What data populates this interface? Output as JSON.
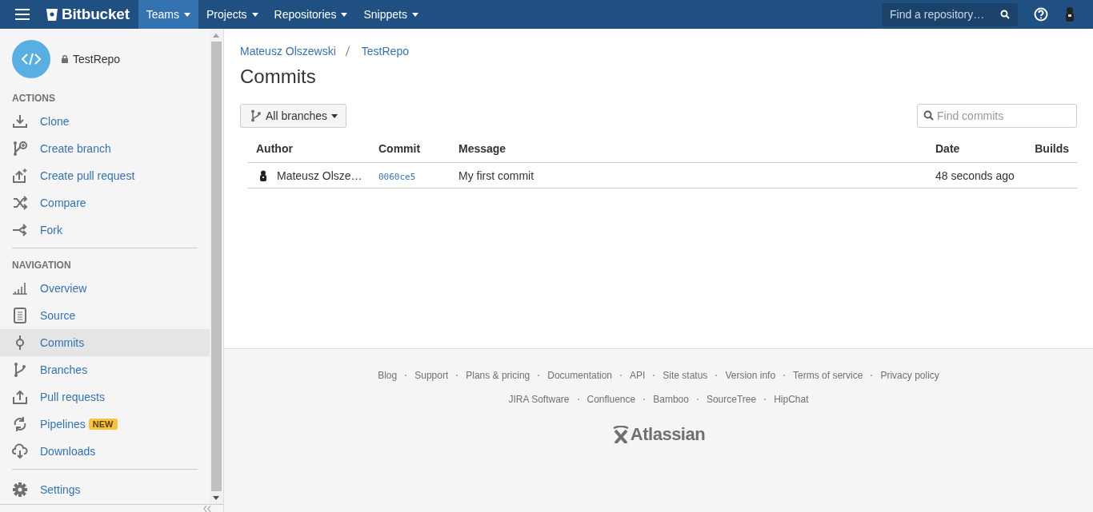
{
  "topbar": {
    "logo": "Bitbucket",
    "menus": [
      {
        "label": "Teams",
        "selected": true
      },
      {
        "label": "Projects",
        "selected": false
      },
      {
        "label": "Repositories",
        "selected": false
      },
      {
        "label": "Snippets",
        "selected": false
      }
    ],
    "search": {
      "placeholder": "Find a repository…"
    }
  },
  "sidebar": {
    "repo": "TestRepo",
    "sections": [
      {
        "heading": "ACTIONS",
        "items": [
          {
            "label": "Clone",
            "selected": false
          },
          {
            "label": "Create branch",
            "selected": false
          },
          {
            "label": "Create pull request",
            "selected": false
          },
          {
            "label": "Compare",
            "selected": false
          },
          {
            "label": "Fork",
            "selected": false
          }
        ]
      },
      {
        "heading": "NAVIGATION",
        "items": [
          {
            "label": "Overview",
            "selected": false
          },
          {
            "label": "Source",
            "selected": false
          },
          {
            "label": "Commits",
            "selected": true
          },
          {
            "label": "Branches",
            "selected": false
          },
          {
            "label": "Pull requests",
            "selected": false
          },
          {
            "label": "Pipelines",
            "selected": false,
            "badge": "NEW"
          },
          {
            "label": "Downloads",
            "selected": false
          }
        ]
      },
      {
        "items": [
          {
            "label": "Settings",
            "selected": false
          }
        ]
      }
    ]
  },
  "breadcrumb": [
    "Mateusz Olszewski",
    "TestRepo"
  ],
  "title": "Commits",
  "branch_filter": "All branches",
  "commit_search": {
    "placeholder": "Find commits"
  },
  "table": {
    "columns": [
      "Author",
      "Commit",
      "Message",
      "Date",
      "Builds"
    ],
    "rows": [
      {
        "author": "Mateusz Olsze…",
        "commit": "0060ce5",
        "message": "My first commit",
        "date": "48 seconds ago"
      }
    ]
  },
  "footer": {
    "links": [
      "Blog",
      "Support",
      "Plans & pricing",
      "Documentation",
      "API",
      "Site status",
      "Version info",
      "Terms of service",
      "Privacy policy"
    ],
    "products": [
      "JIRA Software",
      "Confluence",
      "Bamboo",
      "SourceTree",
      "HipChat"
    ],
    "brand": "Atlassian"
  }
}
